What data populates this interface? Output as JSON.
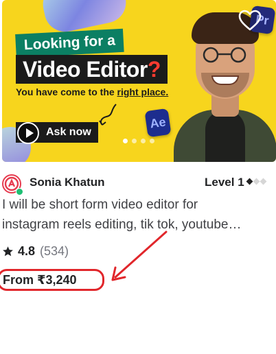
{
  "gig": {
    "image": {
      "headline_top": "Looking for a",
      "headline_main": "Video Editor",
      "headline_mark": "?",
      "tagline_start": "You have come to the ",
      "tagline_emph": "right place.",
      "cta_label": "Ask now",
      "app_icon_1": "Pr",
      "app_icon_2": "Ae",
      "slides": 4,
      "active_slide": 1
    },
    "favorite_icon": "heart-icon",
    "seller": {
      "name": "Sonia Khatun",
      "level": "Level 1",
      "level_max": 3,
      "level_value": 1,
      "online": true
    },
    "title_line1": "I will be short form video editor for",
    "title_line2": "instagram reels editing, tik tok, youtube…",
    "rating": {
      "value": "4.8",
      "count": "(534)"
    },
    "price": "From ₹3,240"
  },
  "colors": {
    "image_bg": "#f7d51d",
    "annotation": "#e1262b",
    "online": "#1dbf73",
    "brand_avatar": "#e63b4f"
  }
}
